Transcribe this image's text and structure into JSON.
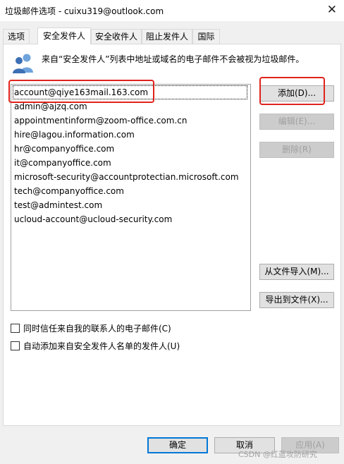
{
  "window": {
    "title": "垃圾邮件选项 - cuixu319@outlook.com",
    "close_glyph": "✕"
  },
  "tabs": [
    {
      "label": "选项",
      "active": false
    },
    {
      "label": "安全发件人",
      "active": true
    },
    {
      "label": "安全收件人",
      "active": false
    },
    {
      "label": "阻止发件人",
      "active": false
    },
    {
      "label": "国际",
      "active": false
    }
  ],
  "panel": {
    "icon": "people-icon",
    "description": "来自“安全发件人”列表中地址或域名的电子邮件不会被视为垃圾邮件。",
    "list": [
      "account@qiye163mail.163.com",
      "admin@ajzq.com",
      "appointmentinform@zoom-office.com.cn",
      "hire@lagou.information.com",
      "hr@companyoffice.com",
      "it@companyoffice.com",
      "microsoft-security@accountprotectian.microsoft.com",
      "tech@companyoffice.com",
      "test@admintest.com",
      "ucloud-account@ucloud-security.com"
    ],
    "buttons": {
      "add": "添加(D)...",
      "edit": "编辑(E)...",
      "remove": "删除(R)",
      "import": "从文件导入(M)...",
      "export": "导出到文件(X)..."
    },
    "checkboxes": [
      {
        "label": "同时信任来自我的联系人的电子邮件(C)",
        "checked": false
      },
      {
        "label": "自动添加来自安全发件人名单的发件人(U)",
        "checked": false
      }
    ]
  },
  "footer": {
    "ok": "确定",
    "cancel": "取消",
    "apply": "应用(A)"
  },
  "watermark": "CSDN @红蓝攻防研究",
  "colors": {
    "annotation": "#e0231b",
    "primary_border": "#0078d7"
  }
}
